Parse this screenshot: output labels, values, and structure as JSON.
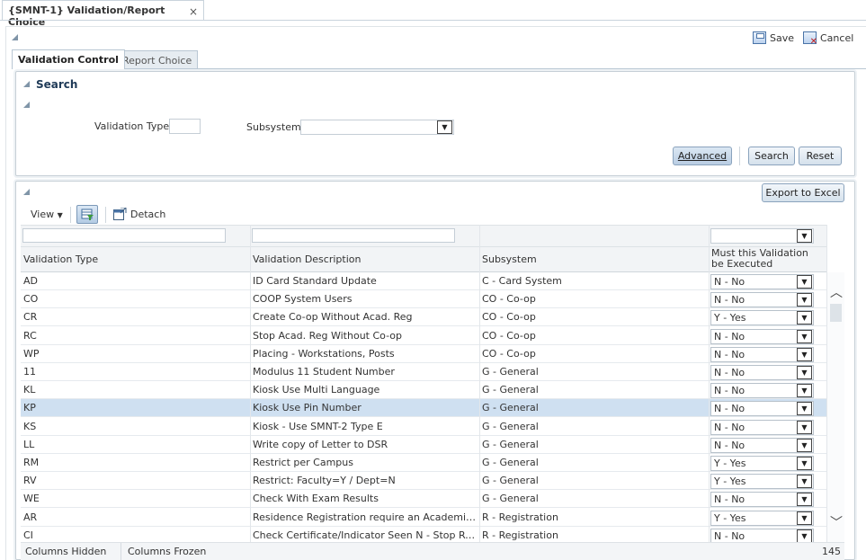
{
  "doc_tab": {
    "title": "{SMNT-1} Validation/Report Choice",
    "close": "×"
  },
  "toolbar": {
    "save_label": "Save",
    "cancel_label": "Cancel"
  },
  "tabs": [
    {
      "label": "Validation Control",
      "active": true
    },
    {
      "label": "Report Choice",
      "active": false
    }
  ],
  "search": {
    "title": "Search",
    "validation_type_label": "Validation Type",
    "validation_type_value": "",
    "subsystem_label": "Subsystem",
    "subsystem_value": "",
    "advanced_label": "Advanced",
    "search_label": "Search",
    "reset_label": "Reset"
  },
  "results": {
    "export_label": "Export to Excel",
    "view_label": "View",
    "detach_label": "Detach",
    "columns": [
      "Validation Type",
      "Validation Description",
      "Subsystem",
      "Must this Validation be Executed"
    ],
    "rows": [
      {
        "type": "AD",
        "desc": "ID Card Standard Update",
        "subsystem": "C - Card System",
        "executed": "N - No"
      },
      {
        "type": "CO",
        "desc": "COOP System Users",
        "subsystem": "CO - Co-op",
        "executed": "N - No"
      },
      {
        "type": "CR",
        "desc": "Create Co-op Without Acad. Reg",
        "subsystem": "CO - Co-op",
        "executed": "Y - Yes"
      },
      {
        "type": "RC",
        "desc": "Stop Acad. Reg Without Co-op",
        "subsystem": "CO - Co-op",
        "executed": "N - No"
      },
      {
        "type": "WP",
        "desc": "Placing - Workstations, Posts",
        "subsystem": "CO - Co-op",
        "executed": "N - No"
      },
      {
        "type": "11",
        "desc": "Modulus 11 Student Number",
        "subsystem": "G - General",
        "executed": "N - No"
      },
      {
        "type": "KL",
        "desc": "Kiosk Use Multi Language",
        "subsystem": "G - General",
        "executed": "N - No"
      },
      {
        "type": "KP",
        "desc": "Kiosk Use Pin Number",
        "subsystem": "G - General",
        "executed": "N - No",
        "selected": true
      },
      {
        "type": "KS",
        "desc": "Kiosk - Use SMNT-2 Type E",
        "subsystem": "G - General",
        "executed": "N - No"
      },
      {
        "type": "LL",
        "desc": "Write copy of Letter to DSR",
        "subsystem": "G - General",
        "executed": "N - No"
      },
      {
        "type": "RM",
        "desc": "Restrict per Campus",
        "subsystem": "G - General",
        "executed": "Y - Yes"
      },
      {
        "type": "RV",
        "desc": "Restrict: Faculty=Y / Dept=N",
        "subsystem": "G - General",
        "executed": "Y - Yes"
      },
      {
        "type": "WE",
        "desc": "Check With Exam Results",
        "subsystem": "G - General",
        "executed": "N - No"
      },
      {
        "type": "AR",
        "desc": "Residence Registration require an Academic Registration",
        "subsystem": "R - Registration",
        "executed": "Y - Yes"
      },
      {
        "type": "CI",
        "desc": "Check Certificate/Indicator Seen N - Stop Registration",
        "subsystem": "R - Registration",
        "executed": "N - No"
      }
    ],
    "footer": {
      "columns_hidden": "Columns Hidden",
      "columns_frozen": "Columns Frozen",
      "count": "145"
    }
  }
}
